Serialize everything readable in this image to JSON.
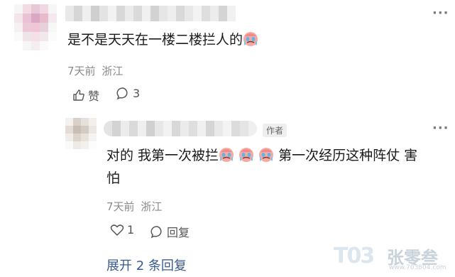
{
  "comment1": {
    "text": "是不是天天在一楼二楼拦人的",
    "emoji": "crying-face-emoji",
    "time": "7天前",
    "location": "浙江",
    "like_label": "赞",
    "reply_count": "3"
  },
  "reply1": {
    "author_tag": "作者",
    "text_a": "对的 我第一次被拦",
    "text_b": " 第一次经历这种阵仗 害",
    "text_c": "怕",
    "emoji_count": 3,
    "time": "7天前",
    "location": "浙江",
    "like_count": "1",
    "reply_label": "回复"
  },
  "expand_label": "展开 2 条回复",
  "watermark": {
    "logo": "T03",
    "name": "张零叁",
    "url": "www.703804.com"
  },
  "colors": {
    "link": "#3a5a8c",
    "meta": "#8a8a8a"
  }
}
